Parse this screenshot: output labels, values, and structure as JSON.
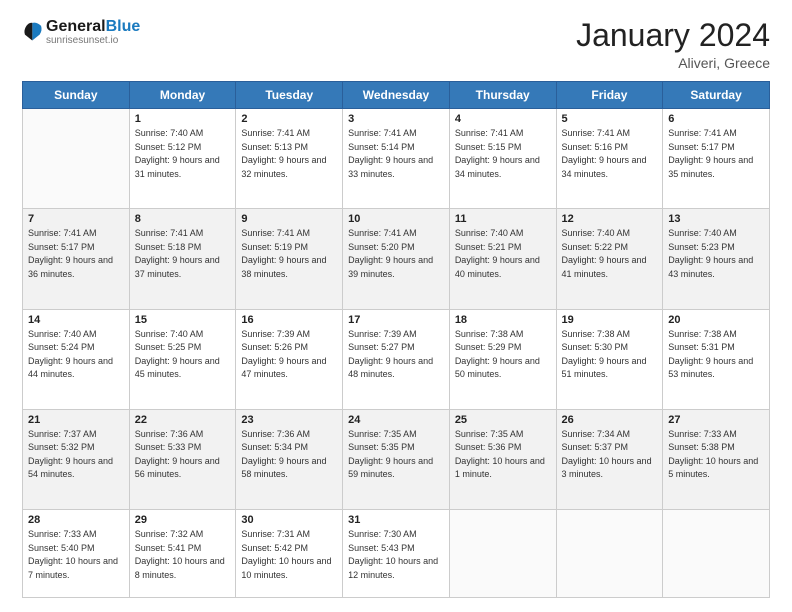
{
  "logo": {
    "line1": "General",
    "line2": "Blue",
    "icon_color": "#1a7abf"
  },
  "header": {
    "month": "January 2024",
    "location": "Aliveri, Greece"
  },
  "weekdays": [
    "Sunday",
    "Monday",
    "Tuesday",
    "Wednesday",
    "Thursday",
    "Friday",
    "Saturday"
  ],
  "weeks": [
    [
      {
        "day": "",
        "sunrise": "",
        "sunset": "",
        "daylight": ""
      },
      {
        "day": "1",
        "sunrise": "Sunrise: 7:40 AM",
        "sunset": "Sunset: 5:12 PM",
        "daylight": "Daylight: 9 hours and 31 minutes."
      },
      {
        "day": "2",
        "sunrise": "Sunrise: 7:41 AM",
        "sunset": "Sunset: 5:13 PM",
        "daylight": "Daylight: 9 hours and 32 minutes."
      },
      {
        "day": "3",
        "sunrise": "Sunrise: 7:41 AM",
        "sunset": "Sunset: 5:14 PM",
        "daylight": "Daylight: 9 hours and 33 minutes."
      },
      {
        "day": "4",
        "sunrise": "Sunrise: 7:41 AM",
        "sunset": "Sunset: 5:15 PM",
        "daylight": "Daylight: 9 hours and 34 minutes."
      },
      {
        "day": "5",
        "sunrise": "Sunrise: 7:41 AM",
        "sunset": "Sunset: 5:16 PM",
        "daylight": "Daylight: 9 hours and 34 minutes."
      },
      {
        "day": "6",
        "sunrise": "Sunrise: 7:41 AM",
        "sunset": "Sunset: 5:17 PM",
        "daylight": "Daylight: 9 hours and 35 minutes."
      }
    ],
    [
      {
        "day": "7",
        "sunrise": "Sunrise: 7:41 AM",
        "sunset": "Sunset: 5:17 PM",
        "daylight": "Daylight: 9 hours and 36 minutes."
      },
      {
        "day": "8",
        "sunrise": "Sunrise: 7:41 AM",
        "sunset": "Sunset: 5:18 PM",
        "daylight": "Daylight: 9 hours and 37 minutes."
      },
      {
        "day": "9",
        "sunrise": "Sunrise: 7:41 AM",
        "sunset": "Sunset: 5:19 PM",
        "daylight": "Daylight: 9 hours and 38 minutes."
      },
      {
        "day": "10",
        "sunrise": "Sunrise: 7:41 AM",
        "sunset": "Sunset: 5:20 PM",
        "daylight": "Daylight: 9 hours and 39 minutes."
      },
      {
        "day": "11",
        "sunrise": "Sunrise: 7:40 AM",
        "sunset": "Sunset: 5:21 PM",
        "daylight": "Daylight: 9 hours and 40 minutes."
      },
      {
        "day": "12",
        "sunrise": "Sunrise: 7:40 AM",
        "sunset": "Sunset: 5:22 PM",
        "daylight": "Daylight: 9 hours and 41 minutes."
      },
      {
        "day": "13",
        "sunrise": "Sunrise: 7:40 AM",
        "sunset": "Sunset: 5:23 PM",
        "daylight": "Daylight: 9 hours and 43 minutes."
      }
    ],
    [
      {
        "day": "14",
        "sunrise": "Sunrise: 7:40 AM",
        "sunset": "Sunset: 5:24 PM",
        "daylight": "Daylight: 9 hours and 44 minutes."
      },
      {
        "day": "15",
        "sunrise": "Sunrise: 7:40 AM",
        "sunset": "Sunset: 5:25 PM",
        "daylight": "Daylight: 9 hours and 45 minutes."
      },
      {
        "day": "16",
        "sunrise": "Sunrise: 7:39 AM",
        "sunset": "Sunset: 5:26 PM",
        "daylight": "Daylight: 9 hours and 47 minutes."
      },
      {
        "day": "17",
        "sunrise": "Sunrise: 7:39 AM",
        "sunset": "Sunset: 5:27 PM",
        "daylight": "Daylight: 9 hours and 48 minutes."
      },
      {
        "day": "18",
        "sunrise": "Sunrise: 7:38 AM",
        "sunset": "Sunset: 5:29 PM",
        "daylight": "Daylight: 9 hours and 50 minutes."
      },
      {
        "day": "19",
        "sunrise": "Sunrise: 7:38 AM",
        "sunset": "Sunset: 5:30 PM",
        "daylight": "Daylight: 9 hours and 51 minutes."
      },
      {
        "day": "20",
        "sunrise": "Sunrise: 7:38 AM",
        "sunset": "Sunset: 5:31 PM",
        "daylight": "Daylight: 9 hours and 53 minutes."
      }
    ],
    [
      {
        "day": "21",
        "sunrise": "Sunrise: 7:37 AM",
        "sunset": "Sunset: 5:32 PM",
        "daylight": "Daylight: 9 hours and 54 minutes."
      },
      {
        "day": "22",
        "sunrise": "Sunrise: 7:36 AM",
        "sunset": "Sunset: 5:33 PM",
        "daylight": "Daylight: 9 hours and 56 minutes."
      },
      {
        "day": "23",
        "sunrise": "Sunrise: 7:36 AM",
        "sunset": "Sunset: 5:34 PM",
        "daylight": "Daylight: 9 hours and 58 minutes."
      },
      {
        "day": "24",
        "sunrise": "Sunrise: 7:35 AM",
        "sunset": "Sunset: 5:35 PM",
        "daylight": "Daylight: 9 hours and 59 minutes."
      },
      {
        "day": "25",
        "sunrise": "Sunrise: 7:35 AM",
        "sunset": "Sunset: 5:36 PM",
        "daylight": "Daylight: 10 hours and 1 minute."
      },
      {
        "day": "26",
        "sunrise": "Sunrise: 7:34 AM",
        "sunset": "Sunset: 5:37 PM",
        "daylight": "Daylight: 10 hours and 3 minutes."
      },
      {
        "day": "27",
        "sunrise": "Sunrise: 7:33 AM",
        "sunset": "Sunset: 5:38 PM",
        "daylight": "Daylight: 10 hours and 5 minutes."
      }
    ],
    [
      {
        "day": "28",
        "sunrise": "Sunrise: 7:33 AM",
        "sunset": "Sunset: 5:40 PM",
        "daylight": "Daylight: 10 hours and 7 minutes."
      },
      {
        "day": "29",
        "sunrise": "Sunrise: 7:32 AM",
        "sunset": "Sunset: 5:41 PM",
        "daylight": "Daylight: 10 hours and 8 minutes."
      },
      {
        "day": "30",
        "sunrise": "Sunrise: 7:31 AM",
        "sunset": "Sunset: 5:42 PM",
        "daylight": "Daylight: 10 hours and 10 minutes."
      },
      {
        "day": "31",
        "sunrise": "Sunrise: 7:30 AM",
        "sunset": "Sunset: 5:43 PM",
        "daylight": "Daylight: 10 hours and 12 minutes."
      },
      {
        "day": "",
        "sunrise": "",
        "sunset": "",
        "daylight": ""
      },
      {
        "day": "",
        "sunrise": "",
        "sunset": "",
        "daylight": ""
      },
      {
        "day": "",
        "sunrise": "",
        "sunset": "",
        "daylight": ""
      }
    ]
  ]
}
